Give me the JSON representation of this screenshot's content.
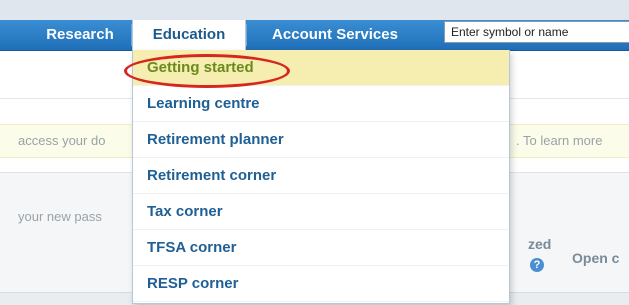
{
  "nav": {
    "tabs": [
      "Research",
      "Education",
      "Account Services"
    ],
    "search_placeholder": "Enter symbol or name"
  },
  "background": {
    "notice_left": "access your do",
    "notice_right": ". To learn more",
    "password_left": "your new pass",
    "col_zed": "zed",
    "col_open": "Open c",
    "help_icon": "?"
  },
  "dropdown": {
    "items": [
      "Getting started",
      "Learning centre",
      "Retirement planner",
      "Retirement corner",
      "Tax corner",
      "TFSA corner",
      "RESP corner"
    ]
  },
  "colors": {
    "nav_blue": "#2a7ec8",
    "highlight_yellow": "#f5eeb0",
    "annotation_red": "#d7261e"
  }
}
